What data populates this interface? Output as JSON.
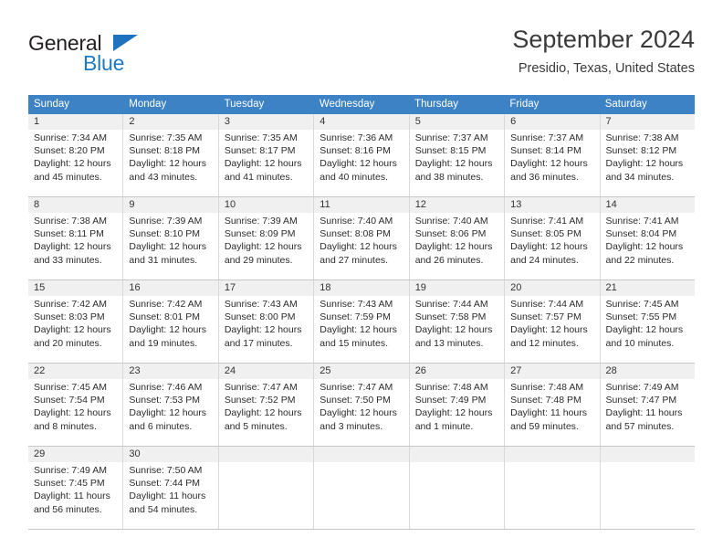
{
  "brand": {
    "name_top": "General",
    "name_bottom": "Blue",
    "accent_color": "#1f7ac4",
    "triangle_icon": "triangle-icon"
  },
  "header": {
    "title": "September 2024",
    "subtitle": "Presidio, Texas, United States"
  },
  "calendar": {
    "header_bg": "#3c82c4",
    "header_text_color": "#ffffff",
    "daynum_band_color": "#f0f0f0",
    "weekdays": [
      "Sunday",
      "Monday",
      "Tuesday",
      "Wednesday",
      "Thursday",
      "Friday",
      "Saturday"
    ],
    "weeks": [
      [
        {
          "day": "1",
          "lines": [
            "Sunrise: 7:34 AM",
            "Sunset: 8:20 PM",
            "Daylight: 12 hours",
            "and 45 minutes."
          ]
        },
        {
          "day": "2",
          "lines": [
            "Sunrise: 7:35 AM",
            "Sunset: 8:18 PM",
            "Daylight: 12 hours",
            "and 43 minutes."
          ]
        },
        {
          "day": "3",
          "lines": [
            "Sunrise: 7:35 AM",
            "Sunset: 8:17 PM",
            "Daylight: 12 hours",
            "and 41 minutes."
          ]
        },
        {
          "day": "4",
          "lines": [
            "Sunrise: 7:36 AM",
            "Sunset: 8:16 PM",
            "Daylight: 12 hours",
            "and 40 minutes."
          ]
        },
        {
          "day": "5",
          "lines": [
            "Sunrise: 7:37 AM",
            "Sunset: 8:15 PM",
            "Daylight: 12 hours",
            "and 38 minutes."
          ]
        },
        {
          "day": "6",
          "lines": [
            "Sunrise: 7:37 AM",
            "Sunset: 8:14 PM",
            "Daylight: 12 hours",
            "and 36 minutes."
          ]
        },
        {
          "day": "7",
          "lines": [
            "Sunrise: 7:38 AM",
            "Sunset: 8:12 PM",
            "Daylight: 12 hours",
            "and 34 minutes."
          ]
        }
      ],
      [
        {
          "day": "8",
          "lines": [
            "Sunrise: 7:38 AM",
            "Sunset: 8:11 PM",
            "Daylight: 12 hours",
            "and 33 minutes."
          ]
        },
        {
          "day": "9",
          "lines": [
            "Sunrise: 7:39 AM",
            "Sunset: 8:10 PM",
            "Daylight: 12 hours",
            "and 31 minutes."
          ]
        },
        {
          "day": "10",
          "lines": [
            "Sunrise: 7:39 AM",
            "Sunset: 8:09 PM",
            "Daylight: 12 hours",
            "and 29 minutes."
          ]
        },
        {
          "day": "11",
          "lines": [
            "Sunrise: 7:40 AM",
            "Sunset: 8:08 PM",
            "Daylight: 12 hours",
            "and 27 minutes."
          ]
        },
        {
          "day": "12",
          "lines": [
            "Sunrise: 7:40 AM",
            "Sunset: 8:06 PM",
            "Daylight: 12 hours",
            "and 26 minutes."
          ]
        },
        {
          "day": "13",
          "lines": [
            "Sunrise: 7:41 AM",
            "Sunset: 8:05 PM",
            "Daylight: 12 hours",
            "and 24 minutes."
          ]
        },
        {
          "day": "14",
          "lines": [
            "Sunrise: 7:41 AM",
            "Sunset: 8:04 PM",
            "Daylight: 12 hours",
            "and 22 minutes."
          ]
        }
      ],
      [
        {
          "day": "15",
          "lines": [
            "Sunrise: 7:42 AM",
            "Sunset: 8:03 PM",
            "Daylight: 12 hours",
            "and 20 minutes."
          ]
        },
        {
          "day": "16",
          "lines": [
            "Sunrise: 7:42 AM",
            "Sunset: 8:01 PM",
            "Daylight: 12 hours",
            "and 19 minutes."
          ]
        },
        {
          "day": "17",
          "lines": [
            "Sunrise: 7:43 AM",
            "Sunset: 8:00 PM",
            "Daylight: 12 hours",
            "and 17 minutes."
          ]
        },
        {
          "day": "18",
          "lines": [
            "Sunrise: 7:43 AM",
            "Sunset: 7:59 PM",
            "Daylight: 12 hours",
            "and 15 minutes."
          ]
        },
        {
          "day": "19",
          "lines": [
            "Sunrise: 7:44 AM",
            "Sunset: 7:58 PM",
            "Daylight: 12 hours",
            "and 13 minutes."
          ]
        },
        {
          "day": "20",
          "lines": [
            "Sunrise: 7:44 AM",
            "Sunset: 7:57 PM",
            "Daylight: 12 hours",
            "and 12 minutes."
          ]
        },
        {
          "day": "21",
          "lines": [
            "Sunrise: 7:45 AM",
            "Sunset: 7:55 PM",
            "Daylight: 12 hours",
            "and 10 minutes."
          ]
        }
      ],
      [
        {
          "day": "22",
          "lines": [
            "Sunrise: 7:45 AM",
            "Sunset: 7:54 PM",
            "Daylight: 12 hours",
            "and 8 minutes."
          ]
        },
        {
          "day": "23",
          "lines": [
            "Sunrise: 7:46 AM",
            "Sunset: 7:53 PM",
            "Daylight: 12 hours",
            "and 6 minutes."
          ]
        },
        {
          "day": "24",
          "lines": [
            "Sunrise: 7:47 AM",
            "Sunset: 7:52 PM",
            "Daylight: 12 hours",
            "and 5 minutes."
          ]
        },
        {
          "day": "25",
          "lines": [
            "Sunrise: 7:47 AM",
            "Sunset: 7:50 PM",
            "Daylight: 12 hours",
            "and 3 minutes."
          ]
        },
        {
          "day": "26",
          "lines": [
            "Sunrise: 7:48 AM",
            "Sunset: 7:49 PM",
            "Daylight: 12 hours",
            "and 1 minute."
          ]
        },
        {
          "day": "27",
          "lines": [
            "Sunrise: 7:48 AM",
            "Sunset: 7:48 PM",
            "Daylight: 11 hours",
            "and 59 minutes."
          ]
        },
        {
          "day": "28",
          "lines": [
            "Sunrise: 7:49 AM",
            "Sunset: 7:47 PM",
            "Daylight: 11 hours",
            "and 57 minutes."
          ]
        }
      ],
      [
        {
          "day": "29",
          "lines": [
            "Sunrise: 7:49 AM",
            "Sunset: 7:45 PM",
            "Daylight: 11 hours",
            "and 56 minutes."
          ]
        },
        {
          "day": "30",
          "lines": [
            "Sunrise: 7:50 AM",
            "Sunset: 7:44 PM",
            "Daylight: 11 hours",
            "and 54 minutes."
          ]
        },
        {
          "day": "",
          "lines": []
        },
        {
          "day": "",
          "lines": []
        },
        {
          "day": "",
          "lines": []
        },
        {
          "day": "",
          "lines": []
        },
        {
          "day": "",
          "lines": []
        }
      ]
    ]
  }
}
